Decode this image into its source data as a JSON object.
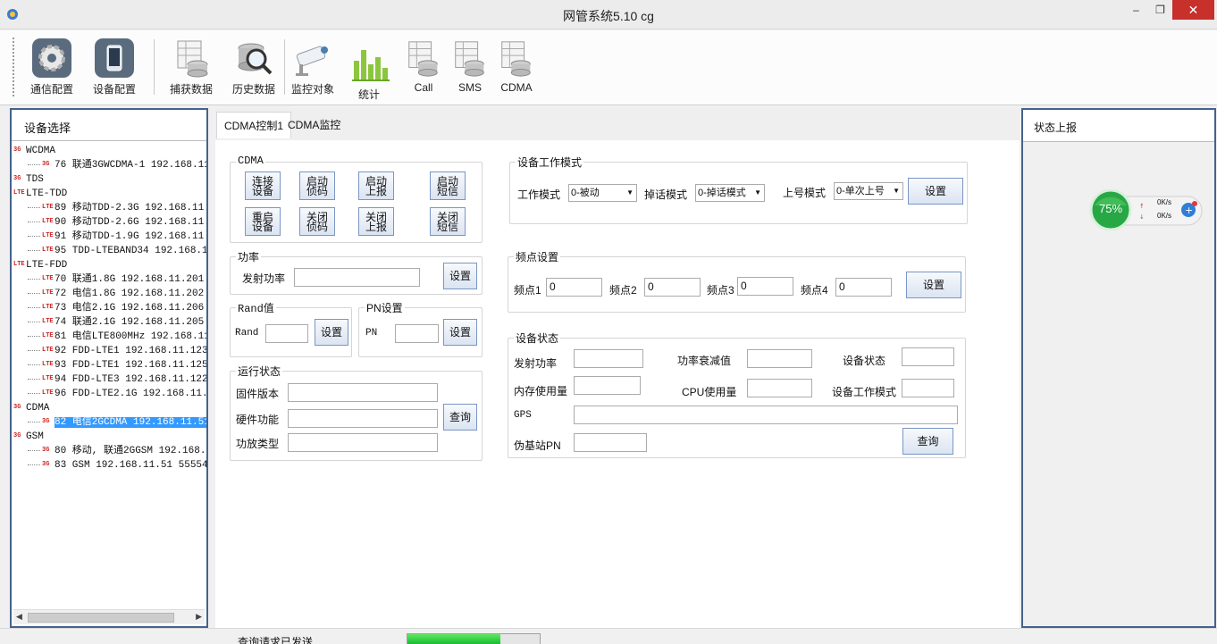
{
  "window": {
    "title": "网管系统5.10 cg",
    "minimize": "–",
    "maximize": "❐",
    "close": "✕"
  },
  "toolbar": {
    "items": [
      {
        "label": "通信配置",
        "icon": "gear-icon"
      },
      {
        "label": "设备配置",
        "icon": "phone-icon"
      },
      {
        "label": "捕获数据",
        "icon": "database-table-icon"
      },
      {
        "label": "历史数据",
        "icon": "magnifier-database-icon"
      },
      {
        "label": "监控对象",
        "icon": "cctv-camera-icon"
      },
      {
        "label": "统计",
        "icon": "bar-chart-icon"
      },
      {
        "label": "Call",
        "icon": "database-table-icon"
      },
      {
        "label": "SMS",
        "icon": "database-table-icon"
      },
      {
        "label": "CDMA",
        "icon": "database-table-icon"
      }
    ]
  },
  "left": {
    "title": "设备选择",
    "tree": [
      {
        "type": "cat",
        "tag": "3G",
        "label": "WCDMA"
      },
      {
        "type": "leaf",
        "tag": "3G",
        "label": "76 联通3GWCDMA-1 192.168.11.20"
      },
      {
        "type": "cat",
        "tag": "3G",
        "label": "TDS"
      },
      {
        "type": "cat",
        "tag": "LTE",
        "label": "LTE-TDD"
      },
      {
        "type": "leaf",
        "tag": "LTE",
        "label": "89 移动TDD-2.3G 192.168.11.100"
      },
      {
        "type": "leaf",
        "tag": "LTE",
        "label": "90 移动TDD-2.6G 192.168.11.101"
      },
      {
        "type": "leaf",
        "tag": "LTE",
        "label": "91 移动TDD-1.9G 192.168.11.102"
      },
      {
        "type": "leaf",
        "tag": "LTE",
        "label": "95 TDD-LTEBAND34 192.168.11.10"
      },
      {
        "type": "cat",
        "tag": "LTE",
        "label": "LTE-FDD"
      },
      {
        "type": "leaf",
        "tag": "LTE",
        "label": "70 联通1.8G 192.168.11.201 920"
      },
      {
        "type": "leaf",
        "tag": "LTE",
        "label": "72 电信1.8G 192.168.11.202 920"
      },
      {
        "type": "leaf",
        "tag": "LTE",
        "label": "73 电信2.1G 192.168.11.206 920"
      },
      {
        "type": "leaf",
        "tag": "LTE",
        "label": "74 联通2.1G 192.168.11.205 920"
      },
      {
        "type": "leaf",
        "tag": "LTE",
        "label": "81 电信LTE800MHz 192.168.11.55"
      },
      {
        "type": "leaf",
        "tag": "LTE",
        "label": "92 FDD-LTE1 192.168.11.123 920"
      },
      {
        "type": "leaf",
        "tag": "LTE",
        "label": "93 FDD-LTE1 192.168.11.125 920"
      },
      {
        "type": "leaf",
        "tag": "LTE",
        "label": "94 FDD-LTE3 192.168.11.122 920"
      },
      {
        "type": "leaf",
        "tag": "LTE",
        "label": "96 FDD-LTE2.1G 192.168.11.120 9"
      },
      {
        "type": "cat",
        "tag": "3G",
        "label": "CDMA"
      },
      {
        "type": "leaf",
        "tag": "3G",
        "label": "82 电信2GCDMA 192.168.11.51 900",
        "selected": true
      },
      {
        "type": "cat",
        "tag": "3G",
        "label": "GSM"
      },
      {
        "type": "leaf",
        "tag": "3G",
        "label": "80 移动, 联通2GGSM 192.168.11.5"
      },
      {
        "type": "leaf",
        "tag": "3G",
        "label": "83 GSM 192.168.11.51 55554"
      }
    ]
  },
  "tabs": [
    {
      "label": "CDMA控制1",
      "active": true
    },
    {
      "label": "CDMA监控",
      "active": false
    }
  ],
  "cdma": {
    "legend": "CDMA",
    "buttons": [
      "连接\n设备",
      "启动\n侦码",
      "启动\n上报",
      "启动\n短信",
      "重启\n设备",
      "关闭\n侦码",
      "关闭\n上报",
      "关闭\n短信"
    ]
  },
  "power": {
    "legend": "功率",
    "label": "发射功率",
    "value": "",
    "button": "设置"
  },
  "rand": {
    "legend": "Rand值",
    "label": "Rand",
    "value": "",
    "button": "设置"
  },
  "pn": {
    "legend": "PN设置",
    "label": "PN",
    "value": "",
    "button": "设置"
  },
  "run": {
    "legend": "运行状态",
    "firmware_label": "固件版本",
    "firmware": "",
    "hardware_label": "硬件功能",
    "hardware": "",
    "amp_label": "功放类型",
    "amp": "",
    "button": "查询"
  },
  "mode": {
    "legend": "设备工作模式",
    "work_label": "工作模式",
    "work_value": "0-被动",
    "drop_label": "掉话模式",
    "drop_value": "0-掉话模式",
    "report_label": "上号模式",
    "report_value": "0-单次上号",
    "button": "设置"
  },
  "freq": {
    "legend": "频点设置",
    "labels": [
      "频点1",
      "频点2",
      "频点3",
      "频点4"
    ],
    "values": [
      "0",
      "0",
      "0",
      "0"
    ],
    "button": "设置"
  },
  "status": {
    "legend": "设备状态",
    "tx_label": "发射功率",
    "tx": "",
    "atten_label": "功率衰减值",
    "atten": "",
    "dev_label": "设备状态",
    "dev": "",
    "mem_label": "内存使用量",
    "mem": "",
    "cpu_label": "CPU使用量",
    "cpu": "",
    "workmode_label": "设备工作模式",
    "workmode": "",
    "gps_label": "GPS",
    "gps": "",
    "pseudo_label": "伪基站PN",
    "pseudo": "",
    "button": "查询"
  },
  "right": {
    "title": "状态上报"
  },
  "widget": {
    "percent": "75%",
    "up": "0K/s",
    "down": "0K/s"
  },
  "statusbar": {
    "message": "查询请求已发送",
    "progress": 0.7
  }
}
